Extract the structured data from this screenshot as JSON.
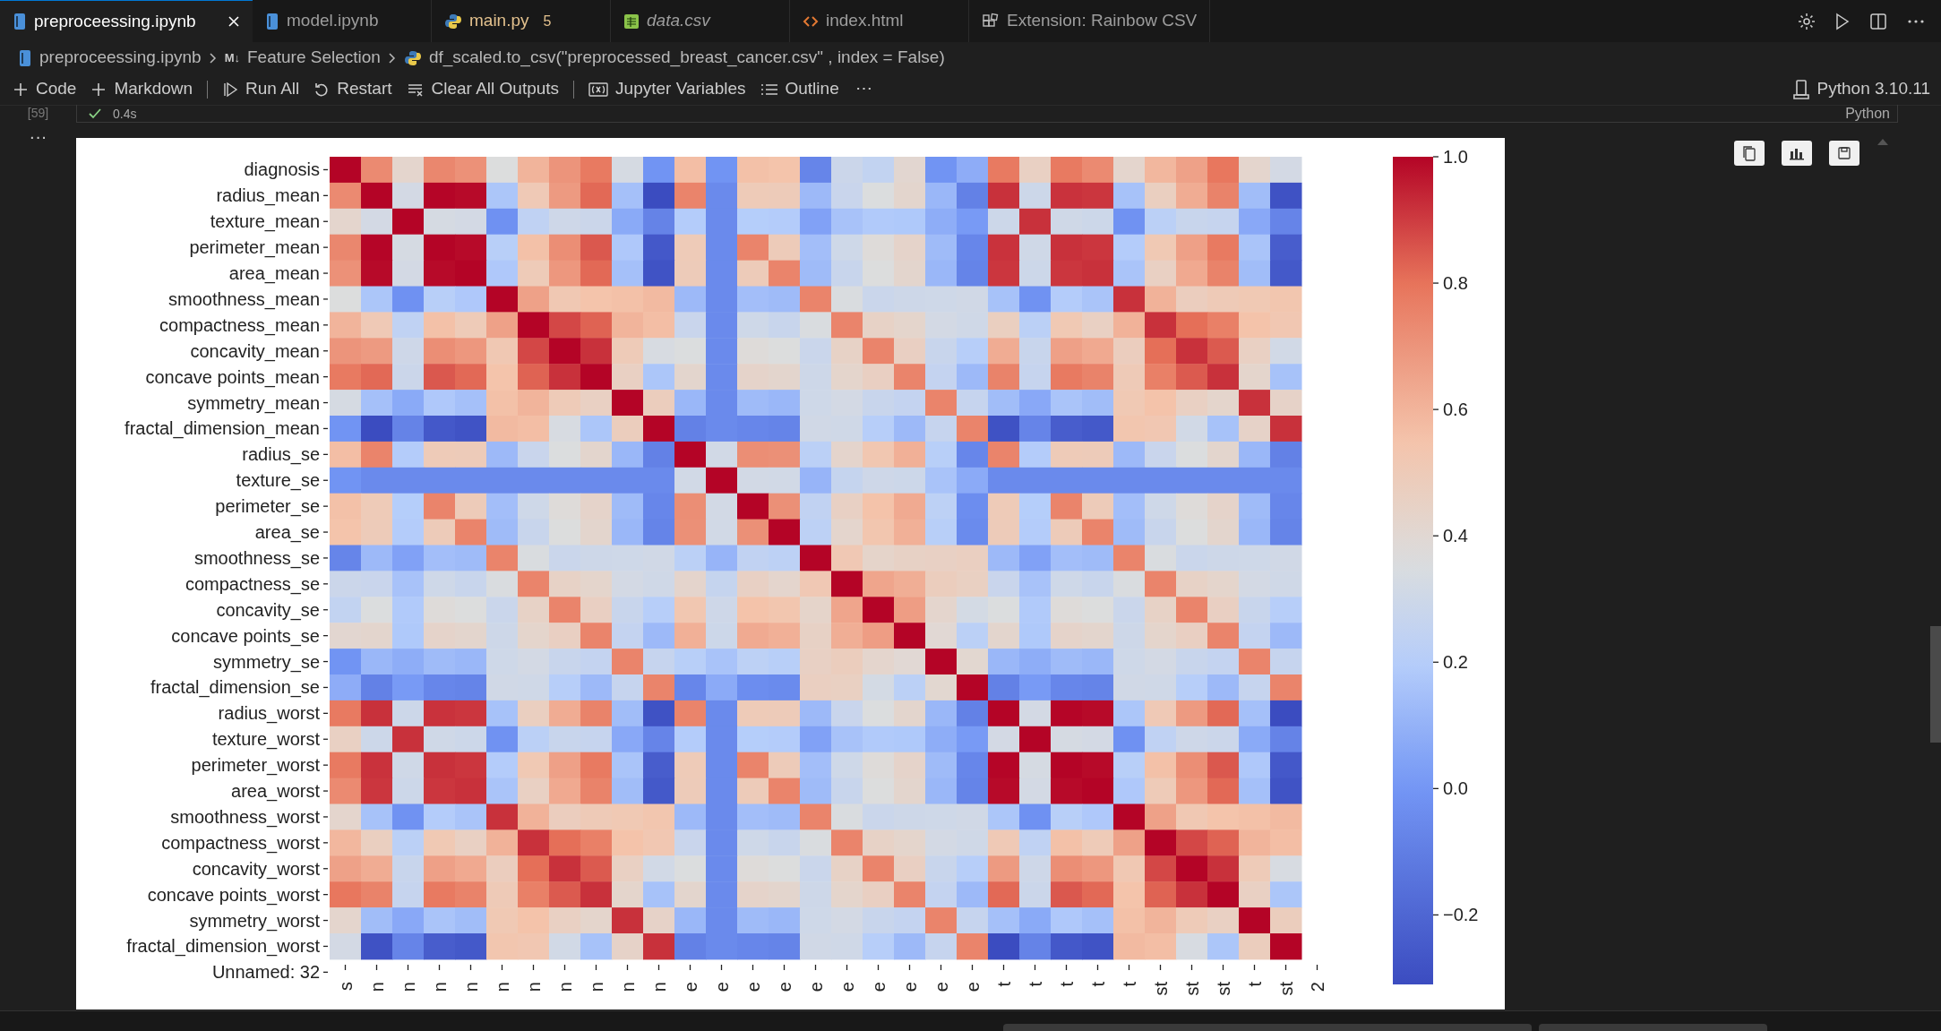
{
  "tabs": [
    {
      "label": "preproceessing.ipynb",
      "kind": "notebook",
      "selected": true,
      "preview": false,
      "warning": false,
      "closable": true
    },
    {
      "label": "model.ipynb",
      "kind": "notebook",
      "selected": false,
      "preview": false,
      "warning": false,
      "closable": false
    },
    {
      "label": "main.py",
      "kind": "python",
      "selected": false,
      "preview": false,
      "warning": true,
      "badge": "5",
      "closable": false
    },
    {
      "label": "data.csv",
      "kind": "csv",
      "selected": false,
      "preview": true,
      "warning": false,
      "closable": false
    },
    {
      "label": "index.html",
      "kind": "html",
      "selected": false,
      "preview": false,
      "warning": false,
      "closable": false
    },
    {
      "label": "Extension: Rainbow CSV",
      "kind": "extension",
      "selected": false,
      "preview": false,
      "warning": false,
      "closable": false
    }
  ],
  "breadcrumbs": [
    {
      "kind": "notebook",
      "label": "preproceessing.ipynb"
    },
    {
      "kind": "markdown",
      "marker": "M↓",
      "label": "Feature Selection"
    },
    {
      "kind": "python",
      "label": "df_scaled.to_csv(\"preprocessed_breast_cancer.csv\" , index = False)"
    }
  ],
  "toolbar": [
    {
      "kind": "plus",
      "label": "Code"
    },
    {
      "kind": "plus",
      "label": "Markdown"
    },
    {
      "kind": "separator"
    },
    {
      "kind": "run",
      "label": "Run All"
    },
    {
      "kind": "restart",
      "label": "Restart"
    },
    {
      "kind": "clear",
      "label": "Clear All Outputs"
    },
    {
      "kind": "separator"
    },
    {
      "kind": "variables",
      "label": "Jupyter Variables"
    },
    {
      "kind": "outline",
      "label": "Outline"
    },
    {
      "kind": "more",
      "label": "⋯"
    }
  ],
  "kernel": "Python 3.10.11",
  "cell": {
    "execution_count": "[59]",
    "succeeded": true,
    "duration": "0.4s",
    "language": "Python",
    "more": "···"
  },
  "heatmap": {
    "row_labels": [
      "diagnosis",
      "radius_mean",
      "texture_mean",
      "perimeter_mean",
      "area_mean",
      "smoothness_mean",
      "compactness_mean",
      "concavity_mean",
      "concave points_mean",
      "symmetry_mean",
      "fractal_dimension_mean",
      "radius_se",
      "texture_se",
      "perimeter_se",
      "area_se",
      "smoothness_se",
      "compactness_se",
      "concavity_se",
      "concave points_se",
      "symmetry_se",
      "fractal_dimension_se",
      "radius_worst",
      "texture_worst",
      "perimeter_worst",
      "area_worst",
      "smoothness_worst",
      "compactness_worst",
      "concavity_worst",
      "concave points_worst",
      "symmetry_worst",
      "fractal_dimension_worst",
      "Unnamed: 32"
    ],
    "column_labels": [
      "s",
      "n",
      "n",
      "n",
      "n",
      "n",
      "n",
      "n",
      "n",
      "n",
      "n",
      "e",
      "e",
      "e",
      "e",
      "e",
      "e",
      "e",
      "e",
      "e",
      "e",
      "t",
      "t",
      "t",
      "t",
      "t",
      "st",
      "st",
      "st",
      "t",
      "st",
      "2"
    ],
    "colorbar_ticks": [
      "1.0",
      "0.8",
      "0.6",
      "0.4",
      "0.2",
      "0.0",
      "−0.2"
    ]
  }
}
